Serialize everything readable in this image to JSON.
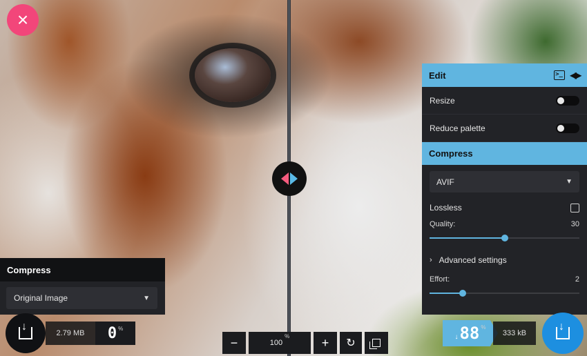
{
  "window": {
    "close_glyph": "×"
  },
  "edit_panel": {
    "title": "Edit",
    "icons": [
      "terminal-icon",
      "split-arrows-icon"
    ],
    "resize_label": "Resize",
    "resize_on": false,
    "reduce_palette_label": "Reduce palette",
    "reduce_palette_on": false
  },
  "compress_panel": {
    "title": "Compress",
    "format": "AVIF",
    "lossless_label": "Lossless",
    "lossless_checked": false,
    "quality_label": "Quality:",
    "quality_value": "30",
    "quality_fraction": 0.5,
    "advanced_label": "Advanced settings",
    "effort_label": "Effort:",
    "effort_value": "2",
    "effort_fraction": 0.22
  },
  "left_panel": {
    "title": "Compress",
    "format": "Original Image"
  },
  "left_stats": {
    "size": "2.79 MB",
    "percent": "0",
    "percent_unit": "%"
  },
  "zoom": {
    "value": "100",
    "unit": "%",
    "minus": "−",
    "plus": "+"
  },
  "right_stats": {
    "sign": "↓",
    "percent": "88",
    "percent_unit": "%",
    "size": "333 kB"
  },
  "colors": {
    "accent": "#60b5e0",
    "close": "#f2467a",
    "download": "#1d8fe0",
    "panel": "#222327"
  }
}
